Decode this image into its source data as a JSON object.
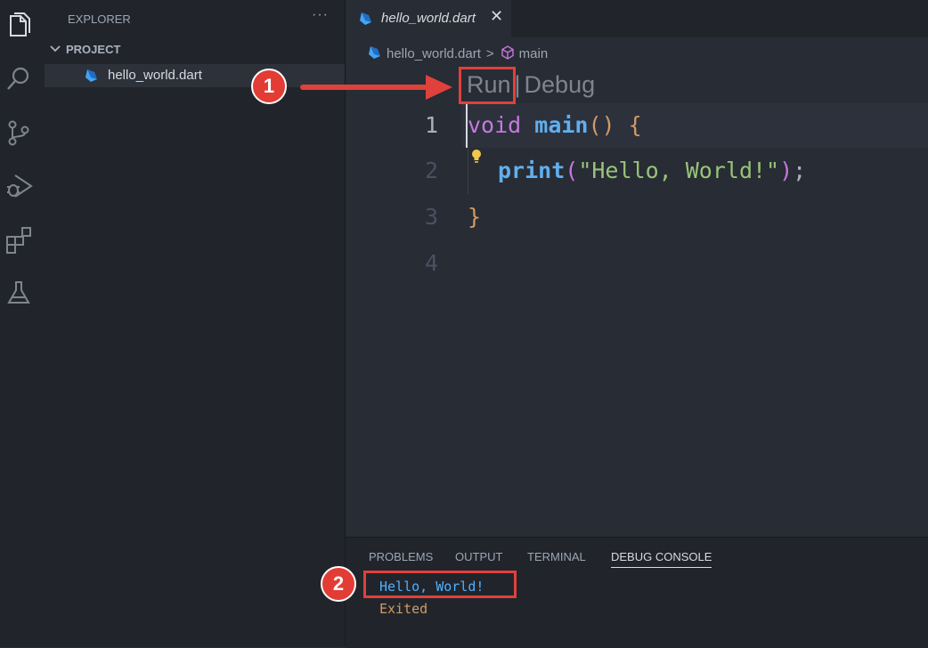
{
  "sidebar": {
    "title": "EXPLORER",
    "more": "···",
    "section": "PROJECT",
    "file": "hello_world.dart"
  },
  "activity_icons": [
    "files-icon",
    "search-icon",
    "source-control-icon",
    "run-debug-icon",
    "extensions-icon",
    "testing-icon"
  ],
  "editor": {
    "tab": {
      "name": "hello_world.dart",
      "close": "✕"
    },
    "breadcrumb": {
      "file": "hello_world.dart",
      "sep": ">",
      "symbol": "main"
    },
    "codelens": {
      "run": "Run",
      "bar": "|",
      "debug": "Debug"
    },
    "line_numbers": [
      "1",
      "2",
      "3",
      "4"
    ],
    "code": {
      "l1_kw": "void",
      "l1_fn": "main",
      "l1_paren": "()",
      "l1_brace": "{",
      "l2_fn": "print",
      "l2_open": "(",
      "l2_str": "\"Hello, World!\"",
      "l2_close": ")",
      "l2_semi": ";",
      "l3_brace": "}"
    }
  },
  "panel": {
    "tabs": [
      "PROBLEMS",
      "OUTPUT",
      "TERMINAL",
      "DEBUG CONSOLE"
    ],
    "active_tab": "DEBUG CONSOLE",
    "output": [
      "Hello, World!",
      "Exited"
    ]
  },
  "annotations": {
    "badge1": "1",
    "badge2": "2"
  },
  "colors": {
    "accent_red": "#e0413b",
    "keyword": "#c678dd",
    "function": "#61afef",
    "string": "#98c379",
    "paren": "#d19a66"
  }
}
